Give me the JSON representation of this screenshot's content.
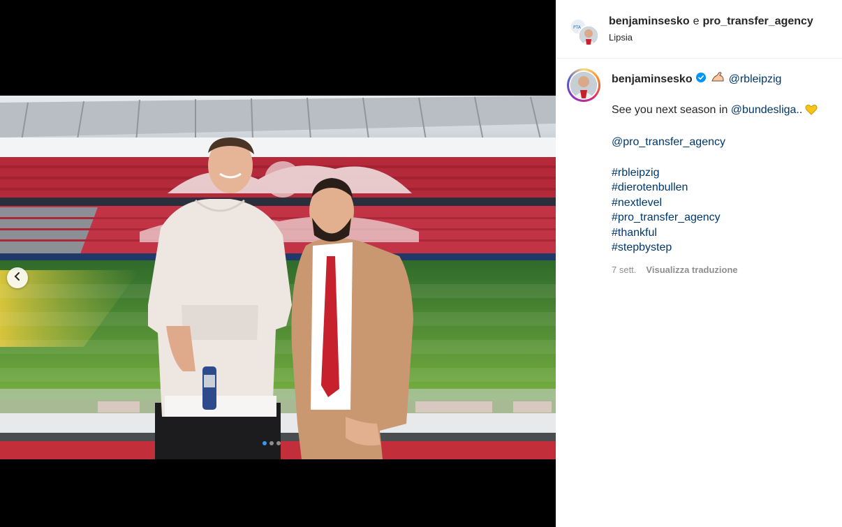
{
  "header": {
    "user_primary": "benjaminsesko",
    "joiner": "e",
    "user_secondary": "pro_transfer_agency",
    "location": "Lipsia"
  },
  "caption": {
    "username": "benjaminsesko",
    "mention_club": "@rbleipzig",
    "line1_text": "See you next season in ",
    "line1_mention": "@bundesliga",
    "line1_suffix": "..",
    "mention_agency": "@pro_transfer_agency",
    "hashtags": [
      "#rbleipzig",
      "#dierotenbullen",
      "#nextlevel",
      "#pro_transfer_agency",
      "#thankful",
      "#stepbystep"
    ],
    "time_ago": "7 sett.",
    "translate_label": "Visualizza traduzione"
  },
  "carousel": {
    "dots": 3,
    "active_index": 0
  },
  "colors": {
    "link": "#00376b",
    "verified": "#0095f6",
    "meta": "#8e8e8e",
    "carousel_active": "#3897f0"
  },
  "icons": {
    "verified": "verified-badge-icon",
    "flex": "flexed-biceps-emoji",
    "heart": "yellow-heart-emoji",
    "prev": "chevron-left-icon"
  }
}
